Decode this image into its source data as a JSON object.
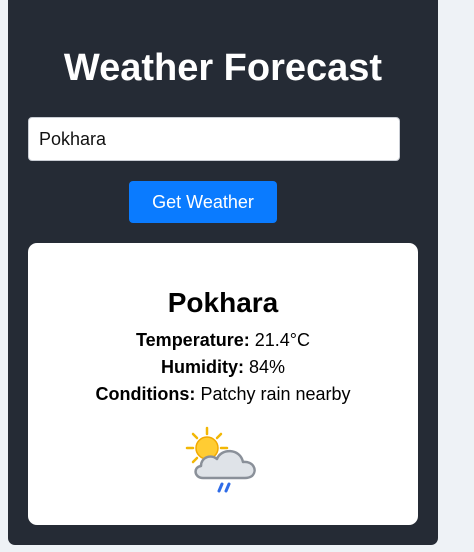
{
  "app": {
    "title": "Weather Forecast"
  },
  "search": {
    "value": "Pokhara",
    "button_label": "Get Weather"
  },
  "result": {
    "city": "Pokhara",
    "temperature": {
      "label": "Temperature:",
      "value": "21.4°C"
    },
    "humidity": {
      "label": "Humidity:",
      "value": "84%"
    },
    "conditions": {
      "label": "Conditions:",
      "value": "Patchy rain nearby"
    },
    "icon": "sun-cloud-rain-icon"
  },
  "colors": {
    "page_background": "#eef2f6",
    "panel_background": "#252b35",
    "button_background": "#0a7bff",
    "card_background": "#ffffff"
  }
}
